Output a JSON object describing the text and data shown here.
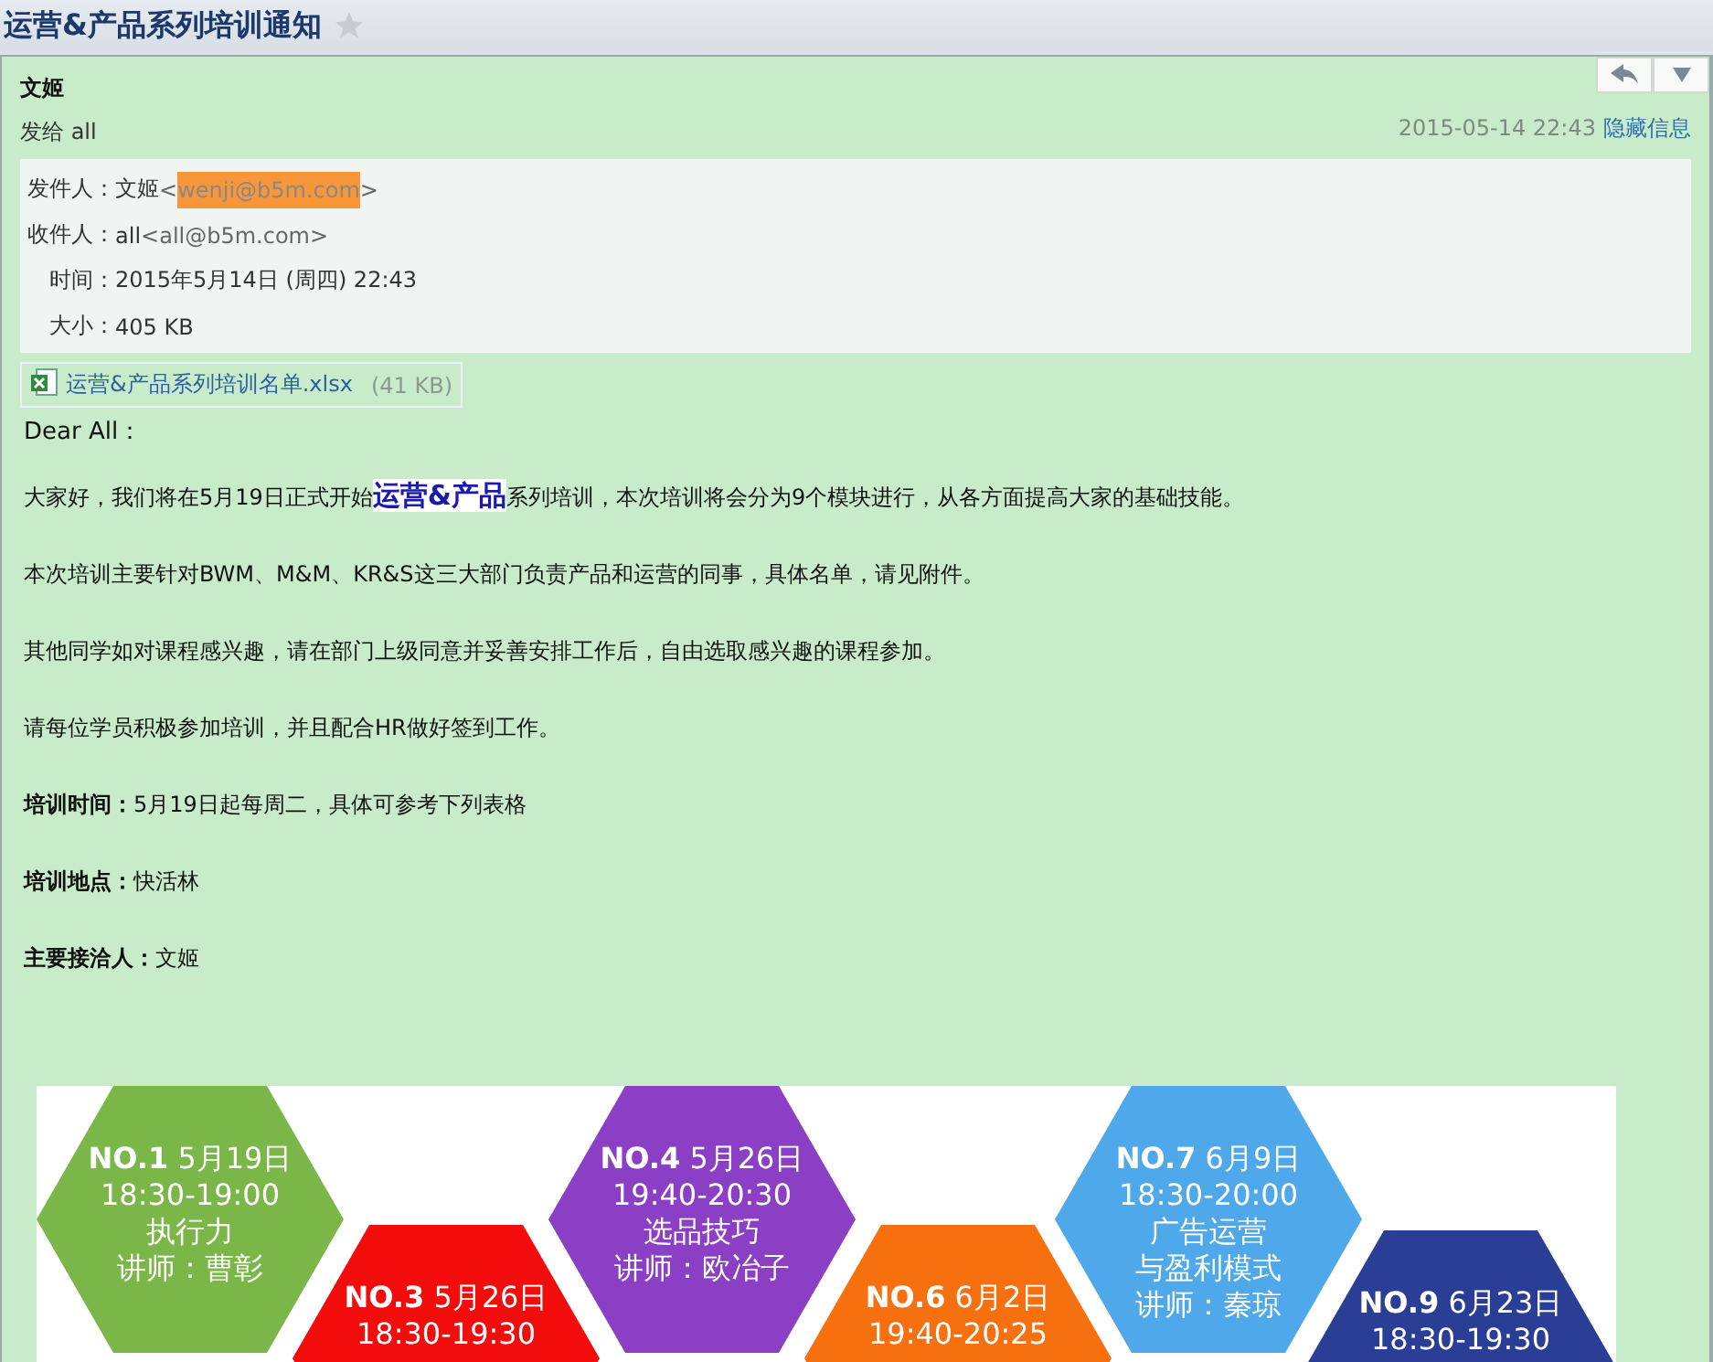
{
  "subject": {
    "title": "运营&产品系列培训通知",
    "starred": false
  },
  "header": {
    "sender": "文姬",
    "to_line": "发给 all",
    "date": "2015-05-14 22:43",
    "toggle_link": "隐藏信息"
  },
  "details": [
    {
      "label": "发件人：",
      "name": "文姬",
      "address": "<",
      "highlight": "wenji@b5m.com",
      "address_end": ">"
    },
    {
      "label": "收件人：",
      "name": "all",
      "address": "<all@b5m.com>"
    },
    {
      "label": "时间：",
      "name": "2015年5月14日 (周四) 22:43"
    },
    {
      "label": "大小：",
      "name": "405 KB"
    }
  ],
  "attachment": {
    "filename": "运营&产品系列培训名单.xlsx",
    "size": "(41 KB)"
  },
  "body": [
    {
      "kind": "greeting",
      "text": "Dear All："
    },
    {
      "kind": "highlight",
      "text": "大家好，我们将在5月19日正式开始**运营&产品**系列培训，本次培训将会分为9个模块进行，从各方面提高大家的基础技能。"
    },
    {
      "kind": "plain",
      "text": "本次培训主要针对BWM、M&M、KR&S这三大部门负责产品和运营的同事，具体名单，请见附件。"
    },
    {
      "kind": "plain",
      "text": "其他同学如对课程感兴趣，请在部门上级同意并妥善安排工作后，自由选取感兴趣的课程参加。"
    },
    {
      "kind": "plain",
      "text": "请每位学员积极参加培训，并且配合HR做好签到工作。"
    },
    {
      "kind": "plain",
      "text": "**培训时间：**5月19日起每周二，具体可参考下列表格"
    },
    {
      "kind": "plain",
      "text": "**培训地点：**快活林"
    },
    {
      "kind": "plain",
      "text": "**主要接洽人：**文姬"
    }
  ],
  "schedule": [
    {
      "number": "NO.1",
      "date": "5月19日",
      "lines": [
        "18:30-19:00",
        "执行力",
        "讲师：曹彰"
      ],
      "color": "#7ab648"
    },
    {
      "number": "NO.3",
      "date": "5月26日",
      "lines": [
        "18:30-19:30"
      ],
      "color": "#f20c0c"
    },
    {
      "number": "NO.4",
      "date": "5月26日",
      "lines": [
        "19:40-20:30",
        "选品技巧",
        "讲师：欧冶子"
      ],
      "color": "#8a3fc4"
    },
    {
      "number": "NO.6",
      "date": "6月2日",
      "lines": [
        "19:40-20:25"
      ],
      "color": "#f7700f"
    },
    {
      "number": "NO.7",
      "date": "6月9日",
      "lines": [
        "18:30-20:00",
        "广告运营",
        "与盈利模式",
        "讲师：秦琼"
      ],
      "color": "#4ea8ea"
    },
    {
      "number": "NO.9",
      "date": "6月23日",
      "lines": [
        "18:30-19:30"
      ],
      "color": "#2a3e96"
    }
  ]
}
